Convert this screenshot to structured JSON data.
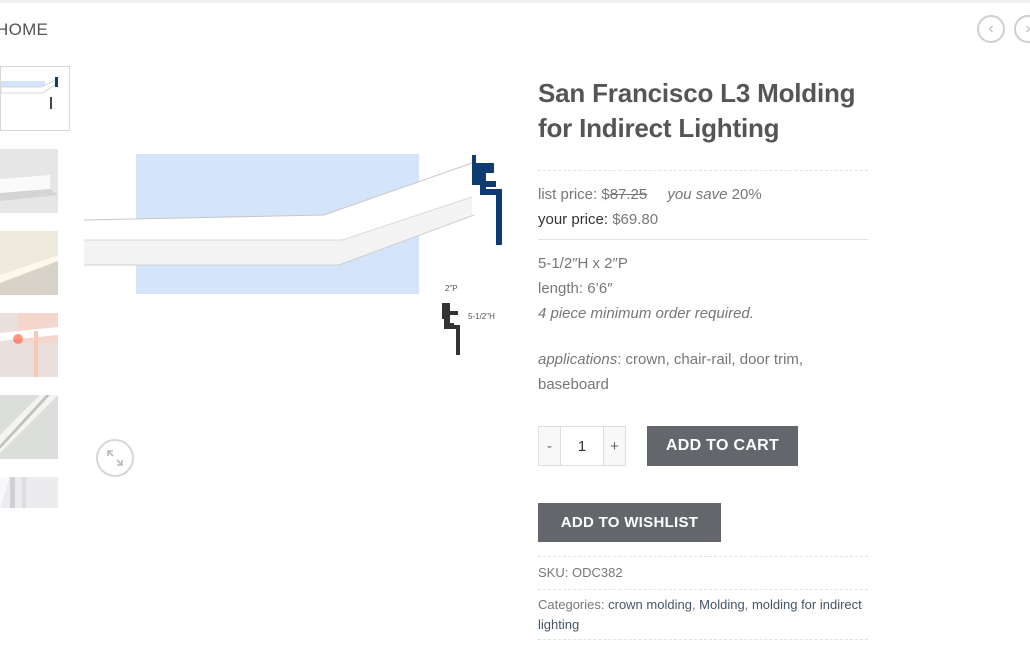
{
  "breadcrumb": {
    "home": "HOME"
  },
  "nav": {
    "prev_icon": "‹",
    "next_icon": "›"
  },
  "product": {
    "title": "San Francisco L3 Molding for Indirect Lighting",
    "list_price_label": "list price: ",
    "list_price_currency": "$",
    "list_price_value": "87.25",
    "you_save_label": "you save",
    "you_save_value": "20%",
    "your_price_label": "your price:",
    "your_price_value": "$69.80",
    "dimensions": "5-1/2″H x 2″P",
    "length": "length: 6’6″",
    "min_order": "4 piece minimum order required.",
    "applications_label": "applications",
    "applications_value": ": crown, chair-rail, door trim, baseboard",
    "image_labels": {
      "depth": "2\"P",
      "height": "5-1/2\"H"
    }
  },
  "quantity": {
    "minus": "-",
    "value": "1",
    "plus": "+"
  },
  "buttons": {
    "add_to_cart": "ADD TO CART",
    "add_to_wishlist": "ADD TO WISHLIST"
  },
  "meta": {
    "sku_label": "SKU:",
    "sku_value": "ODC382",
    "categories_label": "Categories:",
    "categories": [
      "crown molding",
      "Molding",
      "molding for indirect lighting"
    ]
  },
  "colors": {
    "accent_button": "#63666b",
    "link": "#445566",
    "profile_blue": "#0f3b73",
    "light_blue": "#d4e4fb"
  }
}
